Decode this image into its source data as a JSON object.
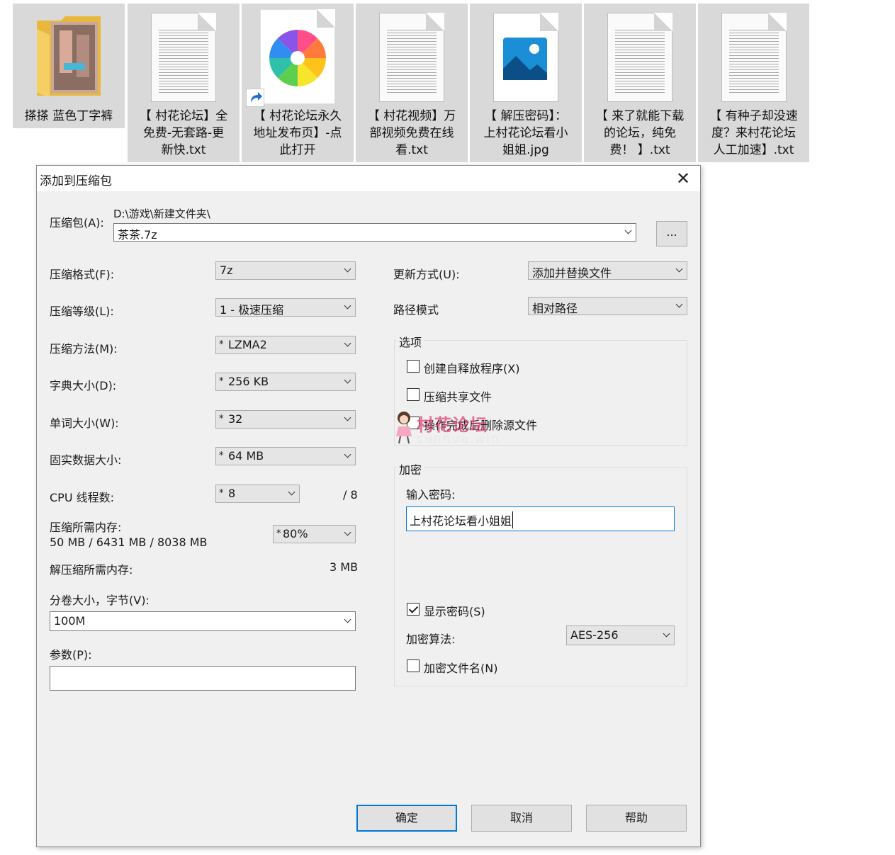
{
  "explorer": {
    "files": [
      {
        "name": "搽搽  蓝色丁字裤",
        "type": "folder"
      },
      {
        "name": "【 村花论坛】全免费-无套路-更新快.txt",
        "line1": "【 村花论坛】全",
        "line2": "免费-无套路-更",
        "line3": "新快.txt",
        "type": "text"
      },
      {
        "name": "【 村花论坛永久地址发布页】-点此打开",
        "line1": "【 村花论坛永久",
        "line2": "地址发布页】-点",
        "line3": "此打开",
        "type": "shortcut"
      },
      {
        "name": "【 村花视频】万部视频免费在线看.txt",
        "line1": "【 村花视频】万",
        "line2": "部视频免费在线",
        "line3": "看.txt",
        "type": "text"
      },
      {
        "name": "【 解压密码】：上村花论坛看小姐姐.jpg",
        "line1": "【 解压密码】：",
        "line2": "上村花论坛看小",
        "line3": "姐姐.jpg",
        "type": "image"
      },
      {
        "name": "【 来了就能下载的论坛，纯免费！ 】.txt",
        "line1": "【 来了就能下载",
        "line2": "的论坛，纯免",
        "line3": "费！ 】.txt",
        "type": "text"
      },
      {
        "name": "【 有种子却没速度？来村花论坛人工加速】.txt",
        "line1": "【 有种子却没速",
        "line2": "度？来村花论坛",
        "line3": "人工加速】.txt",
        "type": "text"
      }
    ]
  },
  "dialog": {
    "title": "添加到压缩包",
    "archive_label": "压缩包(A):",
    "archive_path": "D:\\游戏\\新建文件夹\\",
    "archive_name": "茶茶.7z",
    "browse_label": "...",
    "left": {
      "format_label": "压缩格式(F):",
      "format_value": "7z",
      "level_label": "压缩等级(L):",
      "level_value": "1 - 极速压缩",
      "method_label": "压缩方法(M):",
      "method_value": "LZMA2",
      "dict_label": "字典大小(D):",
      "dict_value": "256 KB",
      "word_label": "单词大小(W):",
      "word_value": "32",
      "solid_label": "固实数据大小:",
      "solid_value": "64 MB",
      "threads_label": "CPU 线程数:",
      "threads_value": "8",
      "threads_total": "/ 8",
      "mem_label": "压缩所需内存:",
      "mem_value": "50 MB / 6431 MB / 8038 MB",
      "mem_pct": "80%",
      "decomp_label": "解压缩所需内存:",
      "decomp_value": "3 MB",
      "volume_label": "分卷大小，字节(V):",
      "volume_value": "100M",
      "params_label": "参数(P):",
      "params_value": "",
      "star": "*"
    },
    "right": {
      "update_label": "更新方式(U):",
      "update_value": "添加并替换文件",
      "path_label": "路径模式",
      "path_value": "相对路径",
      "options_title": "选项",
      "opt_sfx": "创建自释放程序(X)",
      "opt_shared": "压缩共享文件",
      "opt_delete": "操作完成后删除源文件",
      "enc_title": "加密",
      "pwd_label": "输入密码:",
      "pwd_value": "上村花论坛看小姐姐",
      "show_pwd": "显示密码(S)",
      "algo_label": "加密算法:",
      "algo_value": "AES-256",
      "enc_names": "加密文件名(N)"
    },
    "buttons": {
      "ok": "确定",
      "cancel": "取消",
      "help": "帮助"
    }
  },
  "watermark": {
    "text": "村花论坛",
    "url": "cunhua.win"
  },
  "colors": {
    "accent": "#0078d7",
    "dialog_bg": "#f0f0f0",
    "watermark": "#e0457b"
  }
}
